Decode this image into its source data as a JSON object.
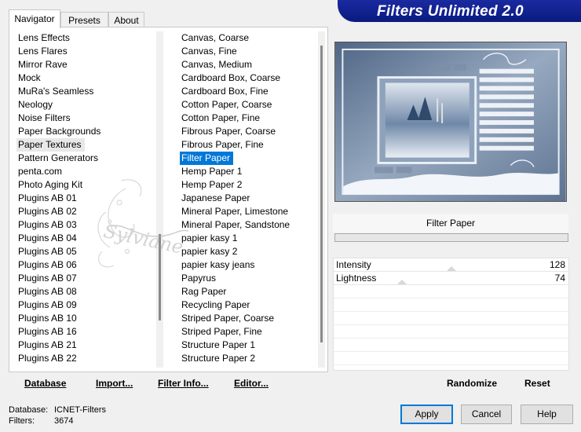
{
  "banner": {
    "title": "Filters Unlimited 2.0"
  },
  "tabs": [
    {
      "label": "Navigator",
      "active": true
    },
    {
      "label": "Presets",
      "active": false
    },
    {
      "label": "About",
      "active": false
    }
  ],
  "categories": [
    "Lens Effects",
    "Lens Flares",
    "Mirror Rave",
    "Mock",
    "MuRa's Seamless",
    "Neology",
    "Noise Filters",
    "Paper Backgrounds",
    "Paper Textures",
    "Pattern Generators",
    "penta.com",
    "Photo Aging Kit",
    "Plugins AB 01",
    "Plugins AB 02",
    "Plugins AB 03",
    "Plugins AB 04",
    "Plugins AB 05",
    "Plugins AB 06",
    "Plugins AB 07",
    "Plugins AB 08",
    "Plugins AB 09",
    "Plugins AB 10",
    "Plugins AB 16",
    "Plugins AB 21",
    "Plugins AB 22"
  ],
  "selected_category": "Paper Textures",
  "filters": [
    "Canvas, Coarse",
    "Canvas, Fine",
    "Canvas, Medium",
    "Cardboard Box, Coarse",
    "Cardboard Box, Fine",
    "Cotton Paper, Coarse",
    "Cotton Paper, Fine",
    "Fibrous Paper, Coarse",
    "Fibrous Paper, Fine",
    "Filter Paper",
    "Hemp Paper 1",
    "Hemp Paper 2",
    "Japanese Paper",
    "Mineral Paper, Limestone",
    "Mineral Paper, Sandstone",
    "papier kasy 1",
    "papier kasy 2",
    "papier kasy jeans",
    "Papyrus",
    "Rag Paper",
    "Recycling Paper",
    "Striped Paper, Coarse",
    "Striped Paper, Fine",
    "Structure Paper 1",
    "Structure Paper 2"
  ],
  "selected_filter": "Filter Paper",
  "preview": {
    "filter_name": "Filter Paper"
  },
  "params": [
    {
      "label": "Intensity",
      "value": "128",
      "fraction": 0.5
    },
    {
      "label": "Lightness",
      "value": "74",
      "fraction": 0.29
    }
  ],
  "toolbar": {
    "database": "Database",
    "import": "Import...",
    "filter_info": "Filter Info...",
    "editor": "Editor...",
    "randomize": "Randomize",
    "reset": "Reset"
  },
  "status": {
    "database_label": "Database:",
    "database_value": "ICNET-Filters",
    "filters_label": "Filters:",
    "filters_value": "3674"
  },
  "buttons": {
    "apply": "Apply",
    "cancel": "Cancel",
    "help": "Help"
  },
  "watermark": {
    "text": "Sylviane"
  },
  "colors": {
    "banner": "#0a1a80",
    "selection": "#0078d7"
  }
}
